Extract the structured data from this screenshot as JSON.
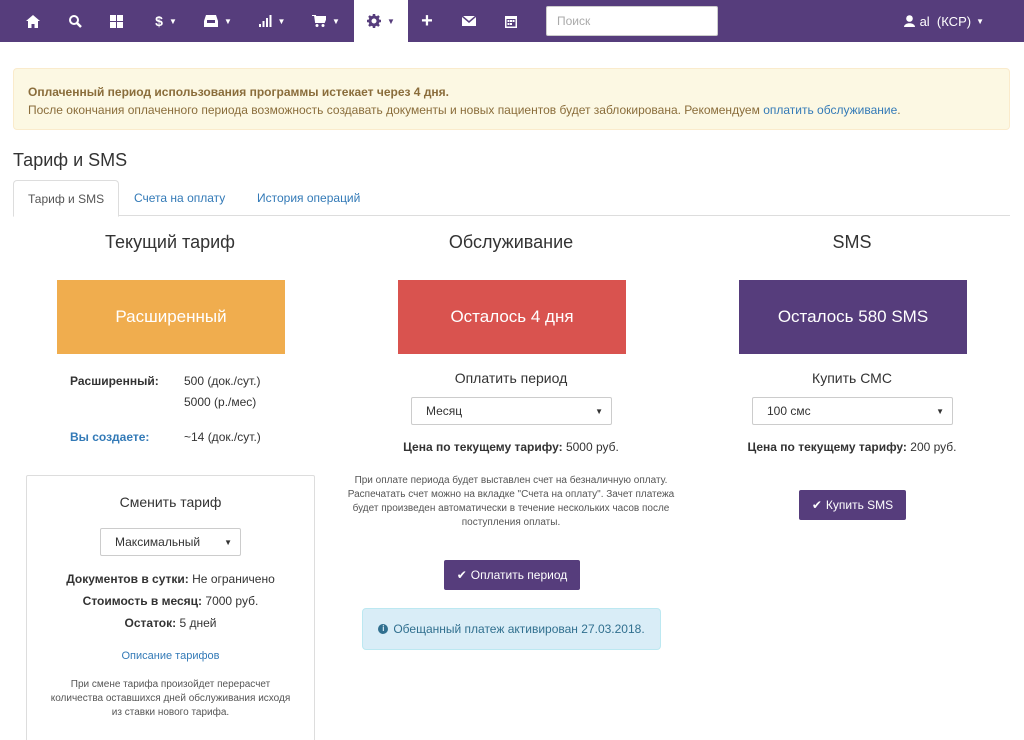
{
  "navbar": {
    "search_placeholder": "Поиск",
    "items": [
      {
        "icon": "home-icon"
      },
      {
        "icon": "search-icon"
      },
      {
        "icon": "grid-icon"
      },
      {
        "icon": "dollar-icon",
        "glyph": "$"
      },
      {
        "icon": "inbox-icon"
      },
      {
        "icon": "signal-icon"
      },
      {
        "icon": "cart-icon"
      },
      {
        "icon": "gear-icon"
      },
      {
        "icon": "plus-icon",
        "glyph": "+"
      },
      {
        "icon": "envelope-icon"
      },
      {
        "icon": "calendar-icon"
      }
    ],
    "user_label": "al  (КСР)"
  },
  "alert": {
    "title": "Оплаченный период использования программы истекает через 4 дня.",
    "text": "После окончания оплаченного периода возможность создавать документы и новых пациентов будет заблокирована. Рекомендуем ",
    "link": "оплатить обслуживание",
    "tail": "."
  },
  "page_title": "Тариф и SMS",
  "tabs": [
    {
      "label": "Тариф и SMS",
      "active": true
    },
    {
      "label": "Счета на оплату",
      "active": false
    },
    {
      "label": "История операций",
      "active": false
    }
  ],
  "tariff": {
    "title": "Текущий тариф",
    "box_label": "Расширенный",
    "box_color": "#f0ad4e",
    "name_label": "Расширенный:",
    "docs_per_day": "500 (док./сут.)",
    "price_per_month": "5000 (р./мес)",
    "you_create_label": "Вы создаете:",
    "you_create_value": "~14 (док./сут.)"
  },
  "change_tariff": {
    "title": "Сменить тариф",
    "selected": "Максимальный",
    "docs_label": "Документов в сутки:",
    "docs_value": "Не ограничено",
    "cost_label": "Стоимость в месяц:",
    "cost_value": "7000 руб.",
    "rest_label": "Остаток:",
    "rest_value": "5 дней",
    "description_link": "Описание тарифов",
    "note_line1": "При смене тарифа произойдет перерасчет",
    "note_line2": "количества оставшихся дней обслуживания исходя",
    "note_line3": "из ставки нового тарифа."
  },
  "service": {
    "title": "Обслуживание",
    "box_label": "Осталось 4 дня",
    "box_color": "#d9534f",
    "pay_period_label": "Оплатить период",
    "selected_period": "Месяц",
    "price_label": "Цена по текущему тарифу:",
    "price_value": "5000 руб.",
    "note_line1": "При оплате периода будет выставлен счет на безналичную оплату.",
    "note_line2": "Распечатать счет можно на вкладке \"Счета на оплату\". Зачет платежа",
    "note_line3": "будет произведен автоматически в течение нескольких часов после",
    "note_line4": "поступления оплаты.",
    "pay_button": "Оплатить период",
    "promise_text": "Обещанный платеж активирован 27.03.2018."
  },
  "sms": {
    "title": "SMS",
    "box_label": "Осталось 580 SMS",
    "box_color": "#563d7c",
    "buy_label": "Купить СМС",
    "selected_amount": "100 смс",
    "price_label": "Цена по текущему тарифу:",
    "price_value": "200 руб.",
    "buy_button": "Купить SMS"
  },
  "colors": {
    "brand": "#563d7c",
    "warning": "#f0ad4e",
    "danger": "#d9534f",
    "link": "#337ab7"
  }
}
